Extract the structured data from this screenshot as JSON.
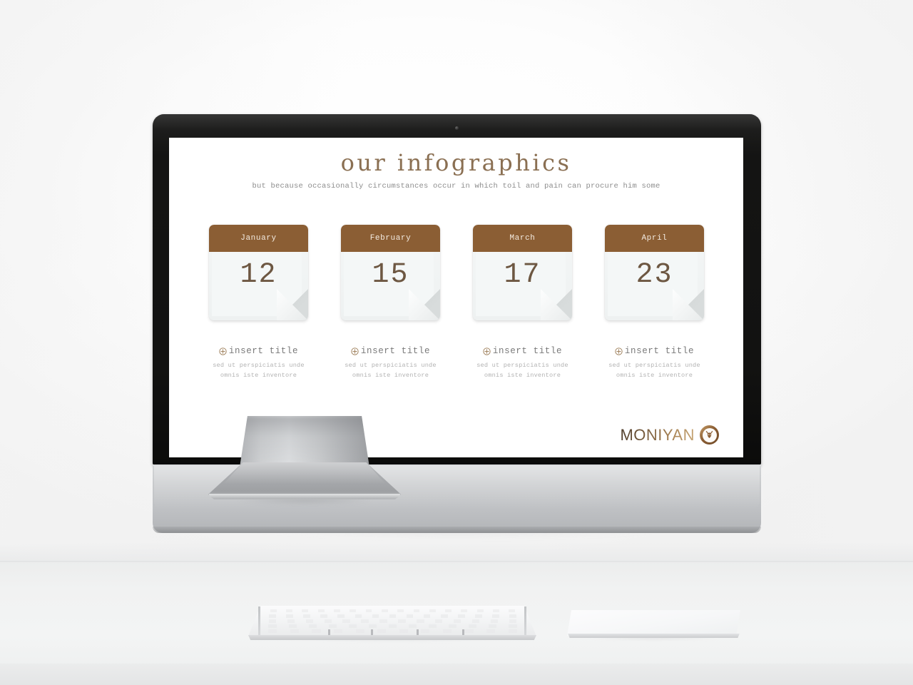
{
  "scene": {
    "device": "imac-desktop-monitor",
    "peripherals": [
      "keyboard",
      "trackpad"
    ]
  },
  "slide": {
    "title": "our infographics",
    "subtitle": "but because occasionally circumstances occur in which toil and pain can procure him some",
    "cards": [
      {
        "month": "January",
        "day": "12",
        "caption_title": "insert title",
        "caption_body": "sed ut perspiciatis unde omnis iste inventore"
      },
      {
        "month": "February",
        "day": "15",
        "caption_title": "insert title",
        "caption_body": "sed ut perspiciatis unde omnis iste inventore"
      },
      {
        "month": "March",
        "day": "17",
        "caption_title": "insert title",
        "caption_body": "sed ut perspiciatis unde omnis iste inventore"
      },
      {
        "month": "April",
        "day": "23",
        "caption_title": "insert title",
        "caption_body": "sed ut perspiciatis unde omnis iste inventore"
      }
    ],
    "logo": {
      "wordmark": "MONIYAN",
      "badge_icon": "deer-head-badge-icon"
    },
    "icons": {
      "caption_bullet": "circled-plus-icon"
    }
  },
  "colors": {
    "accent_brown": "#8b5e34",
    "header_text": "#f4ece2",
    "day_number": "#6d5742",
    "title_text": "#8a6f52",
    "subtitle_text": "#8d8d8d",
    "caption_title_text": "#7a7a7a",
    "caption_body_text": "#b3b3b3",
    "card_body": "#eef1f1",
    "curl_grey": "#d8dcdc",
    "bezel_black": "#121211",
    "chin_silver": "#c8cacc",
    "scene_background": "#fdfdfd"
  }
}
